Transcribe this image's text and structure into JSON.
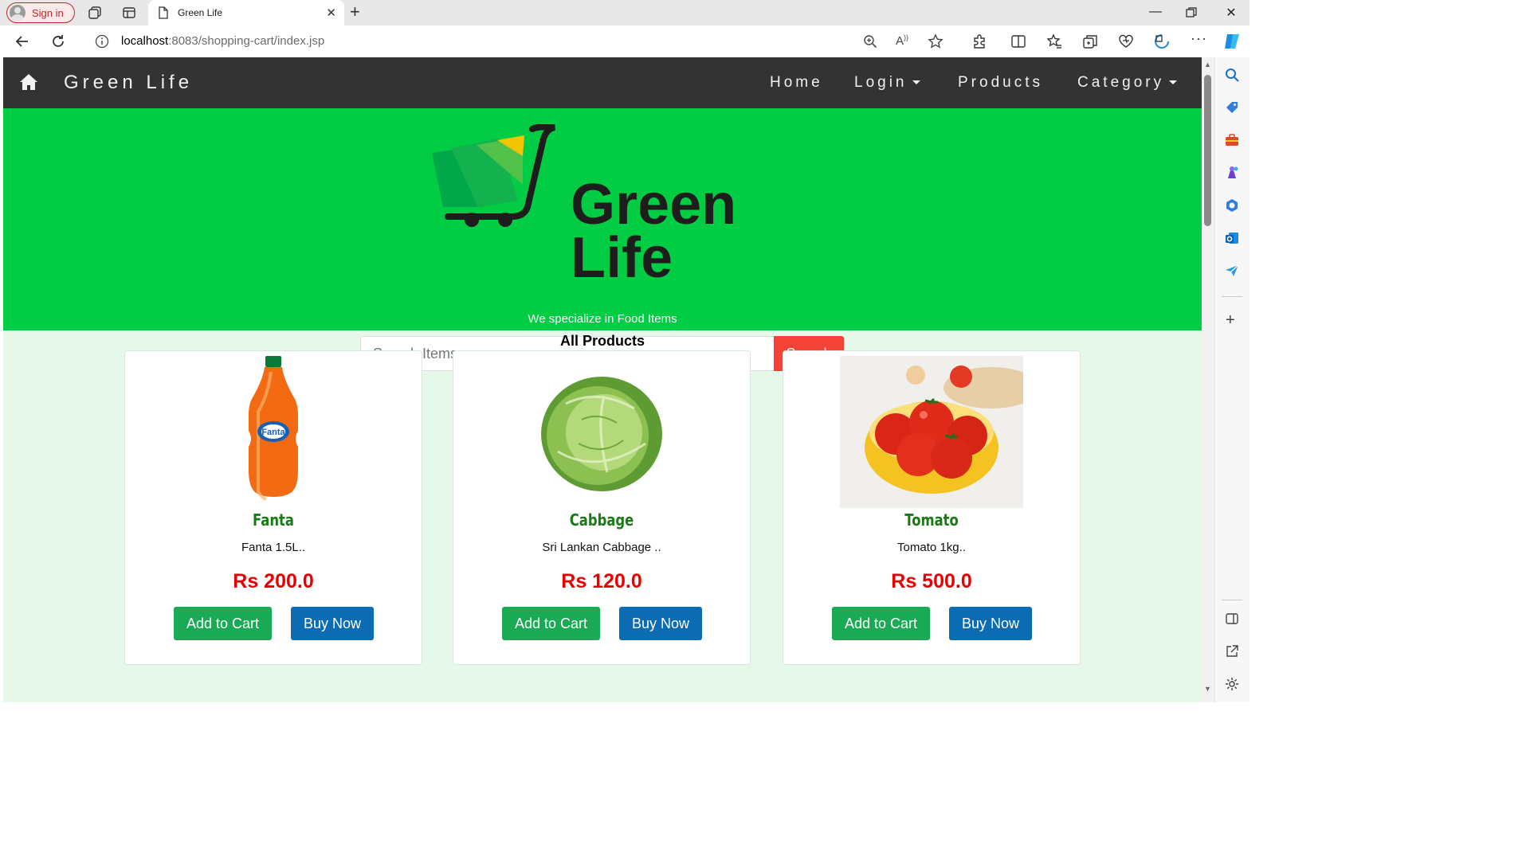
{
  "browser": {
    "signin_label": "Sign in",
    "tab_title": "Green Life",
    "url_host": "localhost",
    "url_rest": ":8083/shopping-cart/index.jsp"
  },
  "site": {
    "brand": "Green Life",
    "nav": {
      "home": "Home",
      "login": "Login",
      "products": "Products",
      "category": "Category"
    },
    "logo_line1": "Green",
    "logo_line2": "Life",
    "tagline": "We specialize in Food Items",
    "search": {
      "placeholder": "Search Items",
      "button": "Search"
    },
    "section_title": "All Products",
    "products": [
      {
        "name": "Fanta",
        "desc": "Fanta 1.5L..",
        "price": "Rs 200.0",
        "image": "orange-soda-bottle"
      },
      {
        "name": "Cabbage",
        "desc": "Sri Lankan Cabbage ..",
        "price": "Rs 120.0",
        "image": "cabbage"
      },
      {
        "name": "Tomato",
        "desc": "Tomato 1kg..",
        "price": "Rs 500.0",
        "image": "tomatoes-in-yellow-bowl"
      }
    ],
    "add_to_cart": "Add to Cart",
    "buy_now": "Buy Now"
  },
  "colors": {
    "navbar": "#333333",
    "hero": "#00cc44",
    "page_bg": "#e5f8ea",
    "search_button": "#f44336",
    "add_to_cart": "#1aaa55",
    "buy_now": "#0b6bb3",
    "price": "#e80000",
    "product_name": "#1a7a14"
  }
}
